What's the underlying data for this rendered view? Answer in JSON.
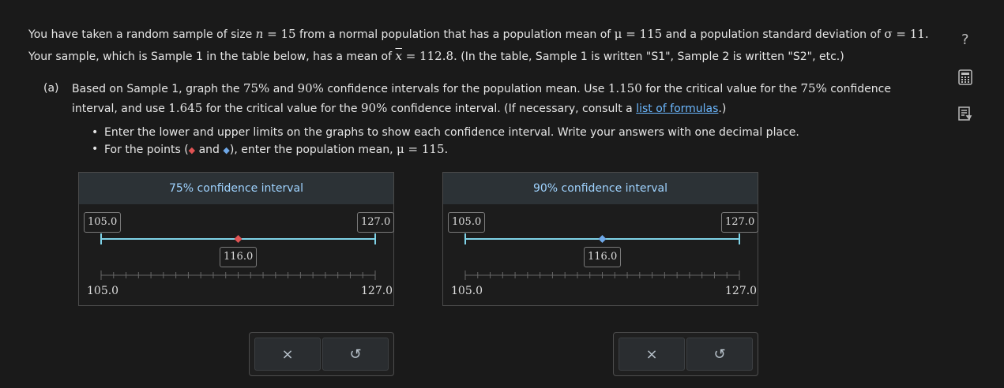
{
  "intro": {
    "line1_a": "You have taken a random sample of size ",
    "n_var": "n",
    "n_eq": " = 15",
    "line1_b": " from a normal population that has a population mean of ",
    "mu": "μ",
    "mu_eq": " = 115",
    "line1_c": " and a population standard deviation of ",
    "sigma": "σ",
    "sigma_eq": " = 11.",
    "line2_a": "Your sample, which is Sample 1 in the table below, has a mean of ",
    "xbar": "x",
    "xbar_eq": " = 112.8.",
    "line2_b": " (In the table, Sample 1 is written \"S1\", Sample 2 is written \"S2\", etc.)"
  },
  "part_a": {
    "label": "(a)",
    "t1": "Based on Sample 1, graph the ",
    "p75": "75%",
    "t2": " and ",
    "p90": "90%",
    "t3": " confidence intervals for the population mean. Use ",
    "cv75": "1.150",
    "t4": " for the critical value for the ",
    "p75b": "75%",
    "t5": " confidence",
    "t6": "interval, and use ",
    "cv90": "1.645",
    "t7": " for the critical value for the ",
    "p90b": "90%",
    "t8": " confidence interval. (If necessary, consult a ",
    "link": "list of formulas",
    "t9": ".)"
  },
  "bullets": {
    "b1": "Enter the lower and upper limits on the graphs to show each confidence interval. Write your answers with one decimal place.",
    "b2_a": "For the points (",
    "b2_red": "◆",
    "b2_and": " and ",
    "b2_blue": "◆",
    "b2_b": "), enter the population mean, ",
    "b2_mu": "μ = 115."
  },
  "graphs": [
    {
      "title": "75% confidence interval",
      "lower": "105.0",
      "upper": "127.0",
      "point": "116.0",
      "axis_min": "105.0",
      "axis_max": "127.0",
      "lower_value": 105.0,
      "upper_value": 127.0,
      "point_value": 116.0,
      "point_color": "#e05353"
    },
    {
      "title": "90% confidence interval",
      "lower": "105.0",
      "upper": "127.0",
      "point": "116.0",
      "axis_min": "105.0",
      "axis_max": "127.0",
      "lower_value": 105.0,
      "upper_value": 127.0,
      "point_value": 116.0,
      "point_color": "#6fa8e8"
    }
  ],
  "buttons": {
    "clear": "×",
    "reset": "↺"
  },
  "side": {
    "help": "?",
    "calculator": "calculator-icon",
    "notes": "notes-icon"
  },
  "colors": {
    "interval_line": "#7fd3e8",
    "link": "#6cb8ff",
    "panel_title": "#9fd3ff"
  }
}
